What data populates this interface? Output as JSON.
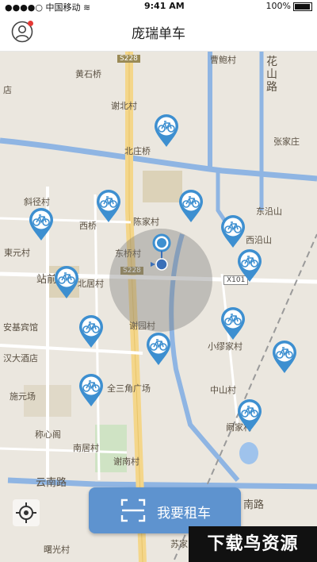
{
  "status_bar": {
    "carrier": "中国移动",
    "time": "9:41 AM",
    "battery": "100%"
  },
  "nav": {
    "title": "庞瑞单车"
  },
  "map": {
    "road_labels": [
      {
        "text": "S228"
      },
      {
        "text": "S228"
      },
      {
        "text": "X101"
      }
    ],
    "places": [
      {
        "text": "黄石桥"
      },
      {
        "text": "曹鲍村"
      },
      {
        "text": "花"
      },
      {
        "text": "山"
      },
      {
        "text": "路"
      },
      {
        "text": "谢北村"
      },
      {
        "text": "张家庄"
      },
      {
        "text": "北庄桥"
      },
      {
        "text": "斜径村"
      },
      {
        "text": "东沿山"
      },
      {
        "text": "西桥"
      },
      {
        "text": "陈家村"
      },
      {
        "text": "西沿山"
      },
      {
        "text": "東元村"
      },
      {
        "text": "东桥村"
      },
      {
        "text": "站前"
      },
      {
        "text": "北居村"
      },
      {
        "text": "安基宾馆"
      },
      {
        "text": "谢园村"
      },
      {
        "text": "小缪家村"
      },
      {
        "text": "汉大酒店"
      },
      {
        "text": "中山村"
      },
      {
        "text": "施元场"
      },
      {
        "text": "全三角广场"
      },
      {
        "text": "阚家村"
      },
      {
        "text": "称心阁"
      },
      {
        "text": "南居村"
      },
      {
        "text": "谢南村"
      },
      {
        "text": "云南路"
      },
      {
        "text": "南路"
      },
      {
        "text": "曙光村"
      },
      {
        "text": "苏家"
      },
      {
        "text": "店"
      }
    ],
    "bike_count": 15
  },
  "rent_button": {
    "label": "我要租车"
  },
  "watermark": {
    "text": "下载鸟资源"
  },
  "colors": {
    "accent": "#5e93cf",
    "pin": "#3d8fd0",
    "road_blue": "#8fb5e3",
    "road_yellow": "#f4d68a"
  }
}
